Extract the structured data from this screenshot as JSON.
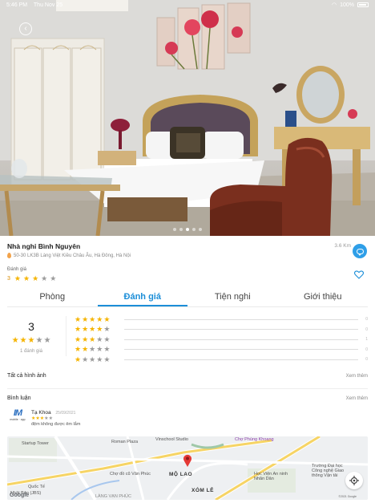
{
  "status_bar": {
    "time": "5:46 PM",
    "date": "Thu Nov 25",
    "battery": "100%"
  },
  "gallery": {
    "total_images": 5,
    "active_index": 2
  },
  "hotel": {
    "name": "Nhà nghỉ Bình Nguyên",
    "distance": "3.6 Km",
    "address": "50-30 LK3B Làng Việt Kiều Châu Âu, Hà Đông, Hà Nội",
    "rating_label": "Đánh giá",
    "rating_value": "3",
    "stars": 3,
    "max_stars": 5
  },
  "tabs": [
    {
      "label": "Phòng",
      "active": false
    },
    {
      "label": "Đánh giá",
      "active": true
    },
    {
      "label": "Tiện nghi",
      "active": false
    },
    {
      "label": "Giới thiệu",
      "active": false
    }
  ],
  "review_summary": {
    "score": "3",
    "stars": 3,
    "count_text": "1 đánh giá",
    "distribution": [
      {
        "stars": 5,
        "count": "0"
      },
      {
        "stars": 4,
        "count": "0"
      },
      {
        "stars": 3,
        "count": "1"
      },
      {
        "stars": 2,
        "count": "0"
      },
      {
        "stars": 1,
        "count": "0"
      }
    ]
  },
  "photos_section": {
    "title": "Tất cả hình ảnh",
    "link": "Xem thêm"
  },
  "comments_section": {
    "title": "Bình luận",
    "link": "Xem thêm"
  },
  "comment": {
    "avatar_text": "IM",
    "avatar_sub": "mobile · app",
    "author": "Tạ Khoa",
    "date": "25/09/2021",
    "stars": 3,
    "text": "đệm không được êm lắm"
  },
  "map": {
    "labels": {
      "startup_tower": "Startup Tower",
      "roman_plaza": "Roman Plaza",
      "vinschool": "Vinschool Studio",
      "cho_phung_khoang": "Chợ Phùng Khoang",
      "cho_do_cu": "Chợ đồ cũ Văn Phúc",
      "mo_lao": "MỘ LAO",
      "xom_le": "XÓM LẺ",
      "hoc_vien": "Học Viện An ninh Nhân Dân",
      "truong_dai_hoc": "Trường Đại học Công nghệ Giao thông Vận tải",
      "nhat_ban": "Nhật Bản (JBS)",
      "quoc_te": "Quốc Tế",
      "lang_van_phuc": "LÀNG VẠN PHÚC"
    },
    "google_mark": "Google",
    "copyright": "©2021 Google"
  }
}
